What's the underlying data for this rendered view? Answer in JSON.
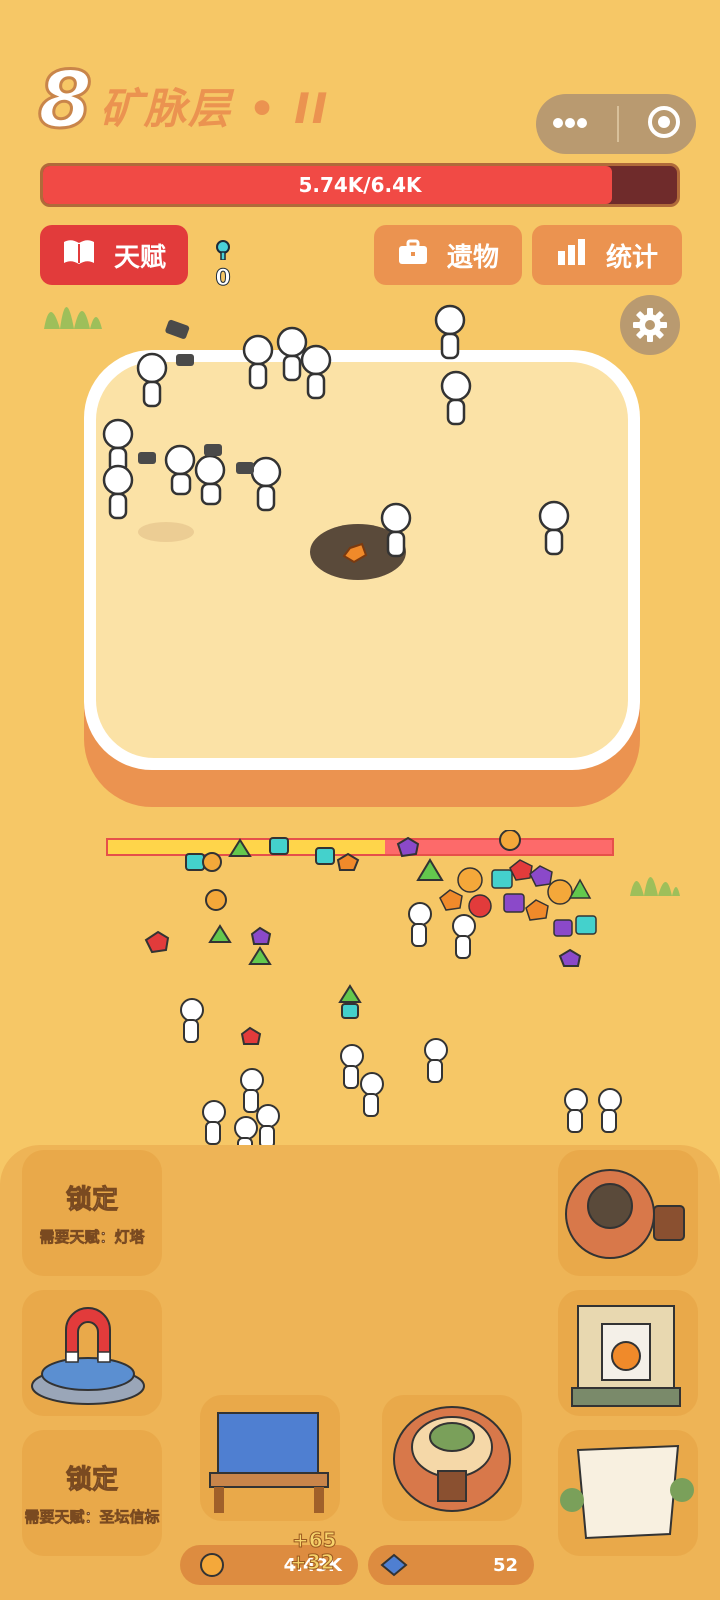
{
  "header": {
    "level_number": "8",
    "level_name": "矿脉层 • II",
    "capsule_more_icon": "more-dots-icon",
    "capsule_close_icon": "record-circle-icon"
  },
  "hp": {
    "text": "5.74K/6.4K",
    "current": 5740,
    "max": 6400
  },
  "buttons": {
    "talent": "天赋",
    "relic": "遗物",
    "stats": "统计"
  },
  "counter": {
    "value": "0"
  },
  "mine_progress": {
    "fraction": 0.55
  },
  "locked_slots": [
    {
      "title": "锁定",
      "requirement": "需要天赋：灯塔"
    },
    {
      "title": "锁定",
      "requirement": "需要天赋：圣坛信标"
    }
  ],
  "resources": {
    "gold": "4.43K",
    "gem": "52",
    "float_1": "+65",
    "float_2": "+32"
  },
  "colors": {
    "background": "#f6c766",
    "accent_red": "#e23b3b",
    "accent_orange": "#eb9350",
    "hp_fill": "#f14a45"
  }
}
